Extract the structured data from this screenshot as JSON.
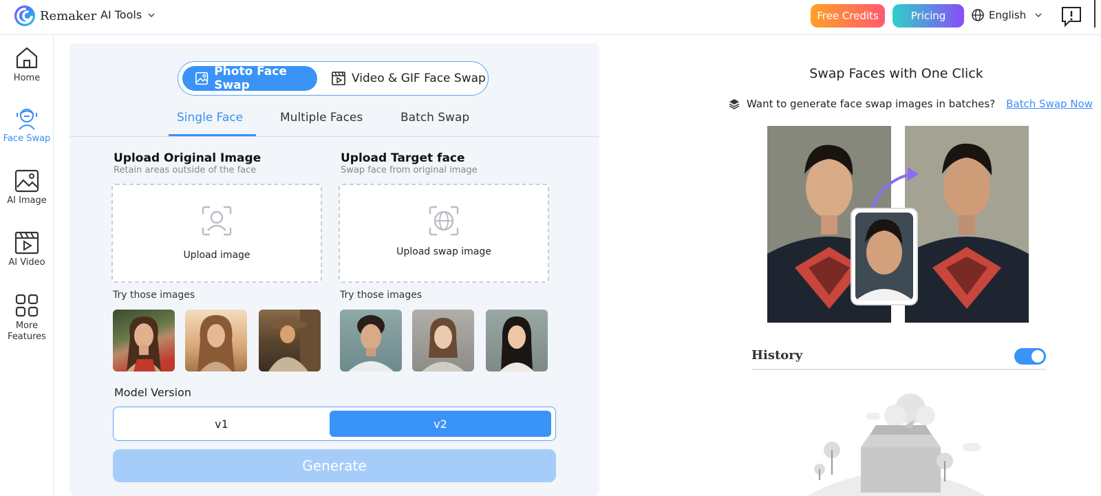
{
  "header": {
    "brand": "Remaker",
    "ai_tools": "AI Tools",
    "free_credits": "Free Credits",
    "pricing": "Pricing",
    "language": "English"
  },
  "sidebar": {
    "items": [
      {
        "label": "Home"
      },
      {
        "label": "Face Swap"
      },
      {
        "label": "AI Image"
      },
      {
        "label": "AI Video"
      },
      {
        "label": "More Features"
      }
    ]
  },
  "main": {
    "modes": {
      "photo": "Photo Face Swap",
      "video": "Video & GIF Face Swap"
    },
    "tabs": [
      "Single Face",
      "Multiple Faces",
      "Batch Swap"
    ],
    "original": {
      "title": "Upload Original Image",
      "subtitle": "Retain areas outside of the face",
      "upload_label": "Upload image"
    },
    "target": {
      "title": "Upload Target face",
      "subtitle": "Swap face from original image",
      "upload_label": "Upload swap image"
    },
    "try_images_label": "Try those images",
    "model_version_label": "Model Version",
    "model_options": [
      "v1",
      "v2"
    ],
    "selected_model": "v2",
    "generate_label": "Generate"
  },
  "right": {
    "title": "Swap Faces with One Click",
    "batch_prompt": "Want to generate face swap images in batches?",
    "batch_link": "Batch Swap Now",
    "history_title": "History",
    "history_enabled": true
  },
  "colors": {
    "accent": "#3a93f6",
    "free_credits_gradient": [
      "#ffa028",
      "#ff5a6e"
    ],
    "pricing_gradient": [
      "#2ed0c8",
      "#8a4cf7"
    ],
    "generate_disabled": "#a6cdf9"
  }
}
